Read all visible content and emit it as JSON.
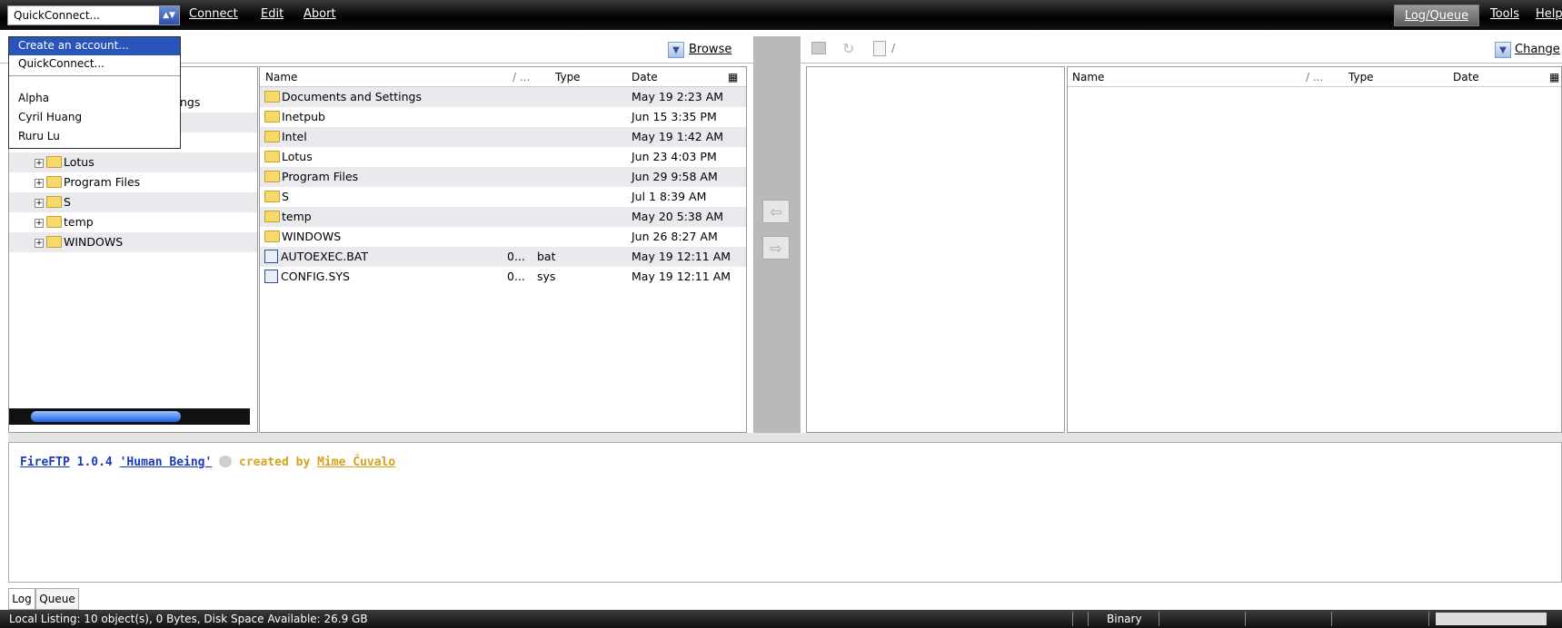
{
  "toolbar": {
    "quickconnect": "QuickConnect...",
    "menus": [
      "Connect",
      "Edit",
      "Abort"
    ],
    "right_menus": [
      "Log/Queue",
      "Tools",
      "Help"
    ]
  },
  "dropdown": {
    "items": [
      "Create an account...",
      "QuickConnect...",
      "Alpha",
      "Cyril Huang",
      "Ruru Lu"
    ]
  },
  "local": {
    "browse_label": "Browse",
    "partial_tree_text": "ngs",
    "tree": [
      "Lotus",
      "Program Files",
      "S",
      "temp",
      "WINDOWS"
    ],
    "headers": [
      "Name",
      "/ ...",
      "Type",
      "Date"
    ],
    "files": [
      {
        "name": "Documents and Settings",
        "size": "",
        "type": "",
        "date": "May 19 2:23 AM",
        "kind": "folder"
      },
      {
        "name": "Inetpub",
        "size": "",
        "type": "",
        "date": "Jun 15 3:35 PM",
        "kind": "folder"
      },
      {
        "name": "Intel",
        "size": "",
        "type": "",
        "date": "May 19 1:42 AM",
        "kind": "folder"
      },
      {
        "name": "Lotus",
        "size": "",
        "type": "",
        "date": "Jun 23 4:03 PM",
        "kind": "folder"
      },
      {
        "name": "Program Files",
        "size": "",
        "type": "",
        "date": "Jun 29 9:58 AM",
        "kind": "folder"
      },
      {
        "name": "S",
        "size": "",
        "type": "",
        "date": "Jul 1 8:39 AM",
        "kind": "folder"
      },
      {
        "name": "temp",
        "size": "",
        "type": "",
        "date": "May 20 5:38 AM",
        "kind": "folder"
      },
      {
        "name": "WINDOWS",
        "size": "",
        "type": "",
        "date": "Jun 26 8:27 AM",
        "kind": "folder"
      },
      {
        "name": "AUTOEXEC.BAT",
        "size": "0...",
        "type": "bat",
        "date": "May 19 12:11 AM",
        "kind": "file"
      },
      {
        "name": "CONFIG.SYS",
        "size": "0...",
        "type": "sys",
        "date": "May 19 12:11 AM",
        "kind": "file"
      }
    ]
  },
  "remote": {
    "path": "/",
    "change_label": "Change",
    "headers": [
      "Name",
      "/ ...",
      "Type",
      "Date"
    ]
  },
  "log": {
    "app": "FireFTP",
    "version": "1.0.4",
    "codename": "'Human Being'",
    "created_by": "created by",
    "author": "Mime Čuvalo"
  },
  "tabs": [
    "Log",
    "Queue"
  ],
  "status": {
    "text": "Local Listing: 10 object(s), 0 Bytes, Disk Space Available: 26.9 GB",
    "mode": "Binary"
  }
}
